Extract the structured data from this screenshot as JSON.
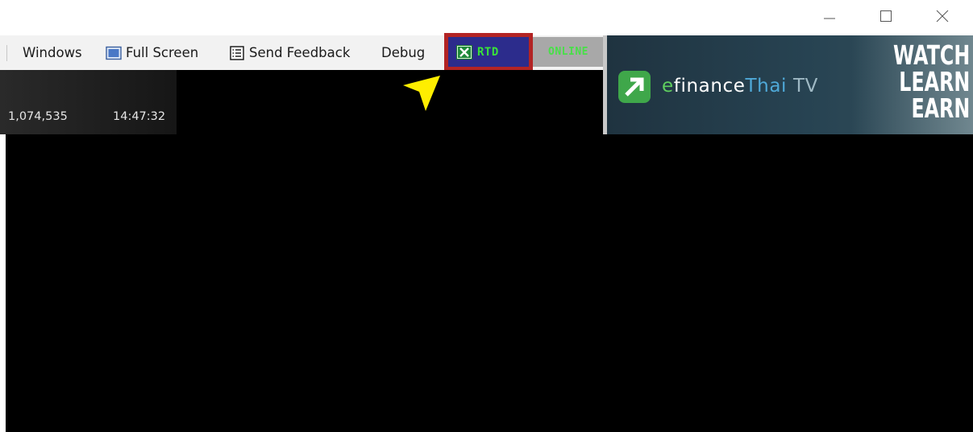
{
  "menu": {
    "windows": "Windows",
    "full_screen": "Full Screen",
    "send_feedback": "Send Feedback",
    "debug": "Debug"
  },
  "status": {
    "rtd": "RTD",
    "online": "ONLINE"
  },
  "ticker": {
    "volume": "1,074,535",
    "time": "14:47:32"
  },
  "banner": {
    "brand_e": "e",
    "brand_finance": "finance",
    "brand_thai": "Thai",
    "brand_tv": "TV",
    "slogan": [
      "WATCH",
      "LEARN",
      "EARN"
    ]
  },
  "colors": {
    "rtd_highlight": "#b32424",
    "rtd_background": "#2c2c8c",
    "status_green": "#39e239",
    "pointer_yellow": "#ffee00"
  },
  "icons": {
    "window_controls": [
      "minimize-icon",
      "maximize-icon",
      "close-icon"
    ],
    "menu": [
      "full-screen-icon",
      "send-feedback-icon"
    ],
    "rtd": "excel-icon",
    "pointer": "arrow-pointer-icon"
  }
}
